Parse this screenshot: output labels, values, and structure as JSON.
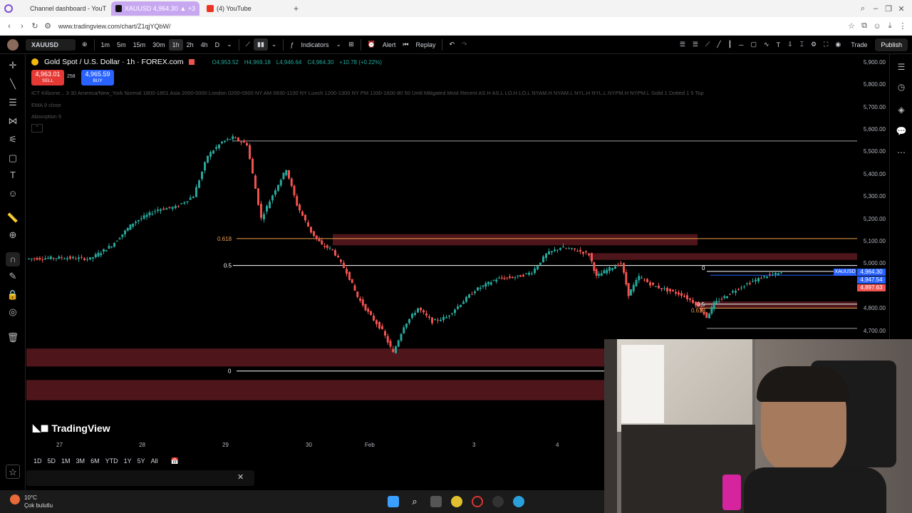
{
  "browser": {
    "tabs": [
      {
        "label": "Channel dashboard - YouT",
        "icon": "youtube-icon"
      },
      {
        "label": "XAUUSD 4,964.30 ▲ +3",
        "icon": "tradingview-icon",
        "active": true
      },
      {
        "label": "(4) YouTube",
        "icon": "youtube-icon"
      }
    ],
    "new_tab": "+",
    "url": "www.tradingview.com/chart/Z1qjYQbW/"
  },
  "toolbar": {
    "symbol": "XAUUSD",
    "timeframes": [
      "1m",
      "5m",
      "15m",
      "30m",
      "1h",
      "2h",
      "4h",
      "D"
    ],
    "active_timeframe": "1h",
    "indicators_label": "Indicators",
    "alert_label": "Alert",
    "replay_label": "Replay",
    "trade_label": "Trade",
    "publish_label": "Publish"
  },
  "symbol_info": {
    "title": "Gold Spot / U.S. Dollar · 1h · FOREX.com",
    "open": "O4,953.52",
    "high": "H4,969.18",
    "low": "L4,946.64",
    "close": "C4,964.30",
    "change": "+10.78 (+0.22%)",
    "sell_price": "4,963.01",
    "sell_label": "SELL",
    "spread": "258",
    "buy_price": "4,965.59",
    "buy_label": "BUY"
  },
  "indicators": {
    "line1": "ICT Killzone... 3 30 America/New_York Normal 1800-1801 Asia 2000-0000 London 0200-0500 NY AM 0930-1100 NY Lunch 1200-1300 NY PM 1330-1600 80 50 Until Mitigated Most Recent AS.H AS.L LO.H LO.L NYAM.H NYAM.L NYL.H NYL.L NYPM.H NYPM.L Solid 1 Dotted 1 5 Top",
    "line2": "EMA 9 close",
    "line3": "Absorption 5"
  },
  "price_axis": [
    "5,900.00",
    "5,800.00",
    "5,700.00",
    "5,600.00",
    "5,500.00",
    "5,400.00",
    "5,300.00",
    "5,200.00",
    "5,100.00",
    "5,000.00",
    "4,800.00",
    "4,700.00"
  ],
  "price_tags": {
    "symbol": "XAUUSD",
    "current": "4,964.30",
    "level1": "4,947.54",
    "level2": "4,897.63"
  },
  "time_axis": [
    "27",
    "28",
    "29",
    "30",
    "Feb",
    "3",
    "4"
  ],
  "range_buttons": [
    "1D",
    "5D",
    "1M",
    "3M",
    "6M",
    "YTD",
    "1Y",
    "5Y",
    "All"
  ],
  "fib_labels": {
    "upper_618": "0.618",
    "upper_05": "0.5",
    "zero_left": "0",
    "zero_right": "0",
    "lower_05": "0.5",
    "lower_618": "0.618"
  },
  "watermark": "TradingView",
  "taskbar": {
    "temperature": "10°C",
    "weather": "Çok bulutlu"
  },
  "colors": {
    "up": "#26a69a",
    "down": "#ef5350",
    "zone": "#5c1a1e",
    "fib_orange": "#f0a050",
    "sell": "#e53935",
    "buy": "#2962ff",
    "tab_active": "#c7a8f0"
  },
  "chart_data": {
    "type": "candlestick",
    "symbol": "XAUUSD",
    "timeframe": "1h",
    "ylim": [
      4550,
      5950
    ],
    "x_ticks": [
      "27",
      "28",
      "29",
      "30",
      "Feb",
      "3",
      "4"
    ],
    "close_path": [
      {
        "x": 0,
        "y": 5020
      },
      {
        "x": 50,
        "y": 5025
      },
      {
        "x": 90,
        "y": 5020
      },
      {
        "x": 120,
        "y": 5080
      },
      {
        "x": 150,
        "y": 5180
      },
      {
        "x": 185,
        "y": 5240
      },
      {
        "x": 210,
        "y": 5250
      },
      {
        "x": 235,
        "y": 5300
      },
      {
        "x": 255,
        "y": 5480
      },
      {
        "x": 275,
        "y": 5540
      },
      {
        "x": 290,
        "y": 5560
      },
      {
        "x": 310,
        "y": 5530
      },
      {
        "x": 330,
        "y": 5200
      },
      {
        "x": 350,
        "y": 5330
      },
      {
        "x": 365,
        "y": 5420
      },
      {
        "x": 380,
        "y": 5260
      },
      {
        "x": 400,
        "y": 5140
      },
      {
        "x": 415,
        "y": 5080
      },
      {
        "x": 430,
        "y": 5060
      },
      {
        "x": 450,
        "y": 4960
      },
      {
        "x": 465,
        "y": 4850
      },
      {
        "x": 480,
        "y": 4780
      },
      {
        "x": 500,
        "y": 4700
      },
      {
        "x": 515,
        "y": 4600
      },
      {
        "x": 530,
        "y": 4720
      },
      {
        "x": 550,
        "y": 4800
      },
      {
        "x": 570,
        "y": 4740
      },
      {
        "x": 590,
        "y": 4760
      },
      {
        "x": 610,
        "y": 4820
      },
      {
        "x": 630,
        "y": 4880
      },
      {
        "x": 660,
        "y": 4930
      },
      {
        "x": 690,
        "y": 4940
      },
      {
        "x": 710,
        "y": 4960
      },
      {
        "x": 730,
        "y": 5040
      },
      {
        "x": 750,
        "y": 5070
      },
      {
        "x": 770,
        "y": 5060
      },
      {
        "x": 790,
        "y": 5040
      },
      {
        "x": 800,
        "y": 4940
      },
      {
        "x": 815,
        "y": 4970
      },
      {
        "x": 835,
        "y": 5000
      },
      {
        "x": 845,
        "y": 4860
      },
      {
        "x": 860,
        "y": 4940
      },
      {
        "x": 880,
        "y": 4900
      },
      {
        "x": 900,
        "y": 4880
      },
      {
        "x": 920,
        "y": 4860
      },
      {
        "x": 940,
        "y": 4820
      },
      {
        "x": 955,
        "y": 4760
      },
      {
        "x": 965,
        "y": 4820
      },
      {
        "x": 980,
        "y": 4850
      },
      {
        "x": 1000,
        "y": 4890
      },
      {
        "x": 1020,
        "y": 4920
      },
      {
        "x": 1040,
        "y": 4945
      },
      {
        "x": 1060,
        "y": 4955
      }
    ],
    "levels": [
      {
        "price": 5545,
        "color": "#9e9e9e"
      },
      {
        "price": 5110,
        "color": "#f0a050"
      },
      {
        "price": 4990,
        "color": "#ffffff"
      },
      {
        "price": 4964,
        "color": "#ffffff"
      },
      {
        "price": 4947,
        "color": "#2962ff"
      },
      {
        "price": 4818,
        "color": "#ffffff"
      },
      {
        "price": 4800,
        "color": "#f0a050"
      },
      {
        "price": 4710,
        "color": "#9e9e9e"
      },
      {
        "price": 4520,
        "color": "#ffffff"
      }
    ],
    "zones": [
      {
        "from": 5130,
        "to": 5080
      },
      {
        "from": 5045,
        "to": 5015
      },
      {
        "from": 4830,
        "to": 4800
      },
      {
        "from": 4620,
        "to": 4540
      },
      {
        "from": 4480,
        "to": 4390
      }
    ]
  }
}
